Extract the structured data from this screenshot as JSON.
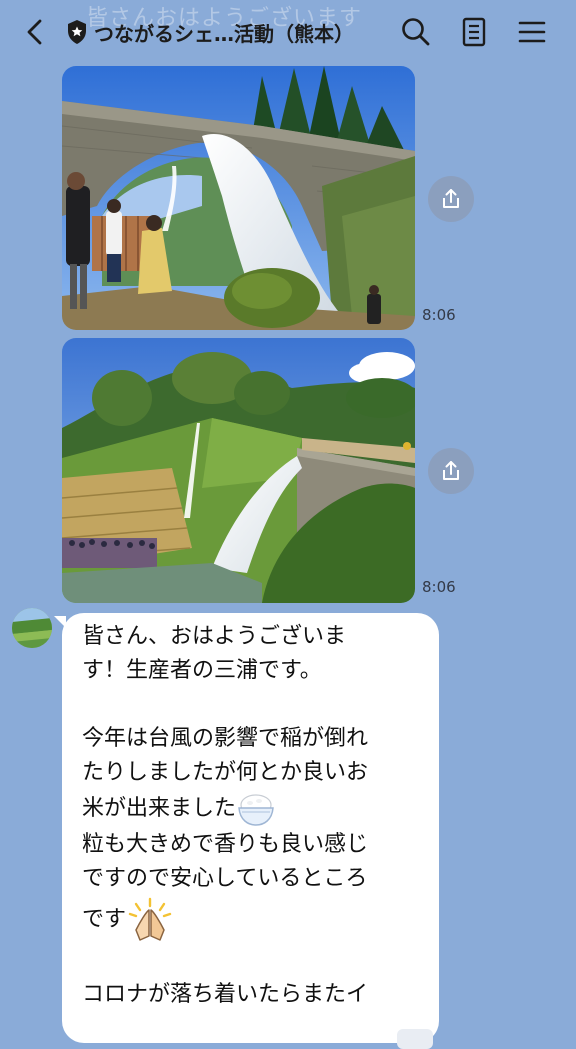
{
  "header": {
    "ghost_text": "皆さんおはようございます",
    "title": "つながるシェ…活動（熊本）",
    "icons": {
      "back": "chevron-left-icon",
      "badge": "shield-icon",
      "search": "search-icon",
      "notes": "notes-icon",
      "menu": "hamburger-menu-icon"
    }
  },
  "messages": [
    {
      "type": "image",
      "description_icon": "photo-aqueduct-waterfall",
      "time": "8:06",
      "action_icon": "share-icon"
    },
    {
      "type": "image",
      "description_icon": "photo-aqueduct-terraces",
      "time": "8:06",
      "action_icon": "share-icon"
    },
    {
      "type": "text",
      "avatar_icon": "user-avatar-icon",
      "lines": {
        "l1": "皆さん、おはようございま",
        "l2": "す！生産者の三浦です。",
        "l3": "今年は台風の影響で稲が倒れ",
        "l4": "たりしましたが何とか良いお",
        "l5": "米が出来ました",
        "l6": "粒も大きめで香りも良い感じ",
        "l7": "ですので安心しているところ",
        "l8": "です",
        "l9": "コロナが落ち着いたらまたイ"
      },
      "emojis": {
        "rice": "rice-bowl-emoji",
        "hands": "praying-hands-emoji"
      }
    }
  ],
  "colors": {
    "background": "#8aabd8",
    "bubble": "#ffffff",
    "share_button": "#8c96aa"
  }
}
